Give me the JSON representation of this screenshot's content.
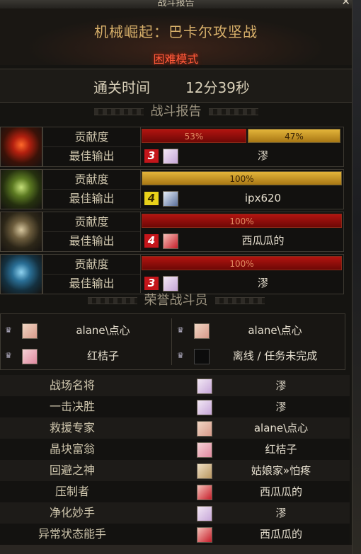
{
  "window": {
    "title": "战斗报告"
  },
  "header": {
    "dungeon_name": "机械崛起：巴卡尔攻坚战",
    "difficulty": "困难模式"
  },
  "clear_time": {
    "label": "通关时间",
    "value": "12分39秒"
  },
  "battle_report": {
    "title": "战斗报告",
    "contribution_label": "贡献度",
    "best_dps_label": "最佳输出",
    "bosses": [
      {
        "icon": "red-boss-portrait",
        "bars": [
          {
            "value": "53%",
            "fraction": 0.53,
            "color": "red"
          },
          {
            "value": "47%",
            "fraction": 0.47,
            "color": "gold"
          }
        ],
        "rank": "3",
        "rank_color": "red",
        "best_name": "漻"
      },
      {
        "icon": "green-boss-portrait",
        "bars": [
          {
            "value": "100%",
            "fraction": 1.0,
            "color": "gold"
          }
        ],
        "rank": "4",
        "rank_color": "yellow",
        "best_name": "ipx620"
      },
      {
        "icon": "gold-boss-portrait",
        "bars": [
          {
            "value": "100%",
            "fraction": 1.0,
            "color": "red"
          }
        ],
        "rank": "4",
        "rank_color": "red",
        "best_name": "西瓜瓜的"
      },
      {
        "icon": "blue-boss-portrait",
        "bars": [
          {
            "value": "100%",
            "fraction": 1.0,
            "color": "red"
          }
        ],
        "rank": "3",
        "rank_color": "red",
        "best_name": "漻"
      }
    ]
  },
  "honor": {
    "title": "荣誉战斗员",
    "members": [
      {
        "name": "alane\\点心"
      },
      {
        "name": "alane\\点心"
      },
      {
        "name": "红桔子"
      },
      {
        "name": "离线 / 任务未完成"
      }
    ]
  },
  "awards": [
    {
      "title": "战场名将",
      "name": "漻"
    },
    {
      "title": "一击决胜",
      "name": "漻"
    },
    {
      "title": "救援专家",
      "name": "alane\\点心"
    },
    {
      "title": "晶块富翁",
      "name": "红桔子"
    },
    {
      "title": "回避之神",
      "name": "姑娘家»怕疼"
    },
    {
      "title": "压制者",
      "name": "西瓜瓜的"
    },
    {
      "title": "净化妙手",
      "name": "漻"
    },
    {
      "title": "异常状态能手",
      "name": "西瓜瓜的"
    }
  ],
  "colors": {
    "accent_gold": "#d8b06a",
    "difficulty_red": "#ff5a3a",
    "bar_red": "#b21410",
    "bar_gold": "#e3b43a"
  }
}
